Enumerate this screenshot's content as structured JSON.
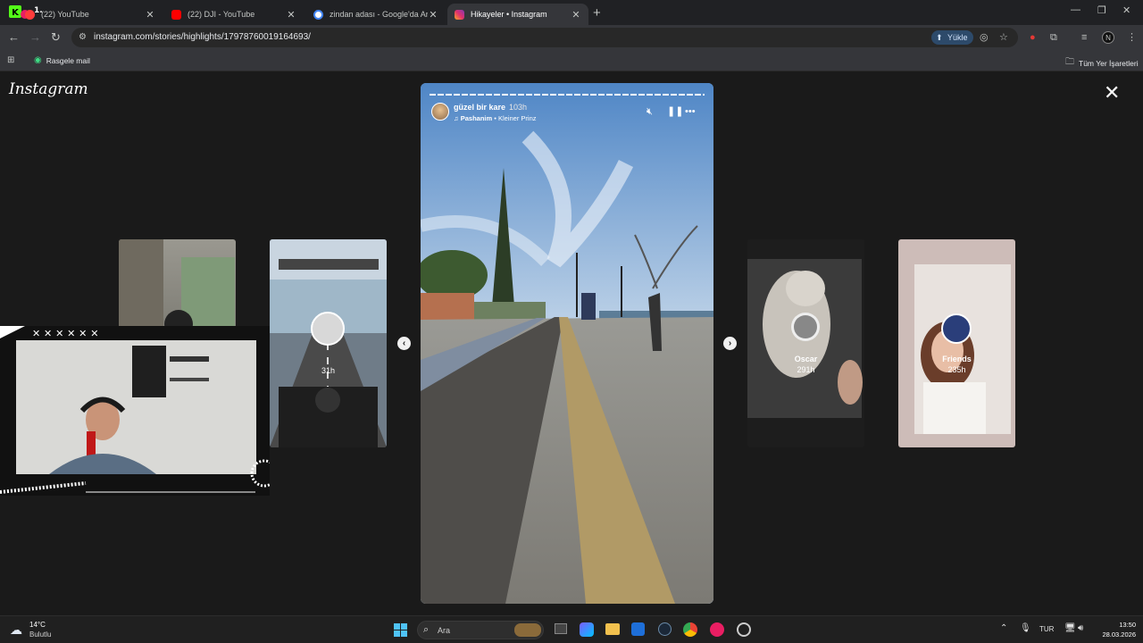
{
  "browser": {
    "tabs": [
      {
        "title": "(22) YouTube",
        "fav_color": "#ff3b3b",
        "active": false
      },
      {
        "title": "(22) DJI - YouTube",
        "fav_color": "#ff0000",
        "active": false
      },
      {
        "title": "zindan adası - Google'da Ara",
        "fav_color": "#4285f4",
        "active": false
      },
      {
        "title": "Hikayeler • Instagram",
        "fav_color": "#e1306c",
        "active": true
      }
    ],
    "url": "instagram.com/stories/highlights/17978760019164693/",
    "upload_label": "Yükle",
    "bookmarks": {
      "left": "Rasgele mail",
      "right": "Tüm Yer İşaretleri"
    }
  },
  "instagram": {
    "logo": "Instagram",
    "current_story": {
      "username": "güzel bir kare",
      "time": "103h",
      "music_artist": "Pashanim",
      "music_title": "Kleiner Prinz"
    },
    "side_stories": [
      {
        "name": "",
        "time": "31h"
      },
      {
        "name": "Oscar",
        "time": "291h"
      },
      {
        "name": "Friends",
        "time": "235h"
      }
    ]
  },
  "taskbar": {
    "weather_temp": "14°C",
    "weather_desc": "Bulutlu",
    "search_placeholder": "Ara",
    "language": "TUR",
    "time": "13:50",
    "date": "28.03.2026"
  }
}
